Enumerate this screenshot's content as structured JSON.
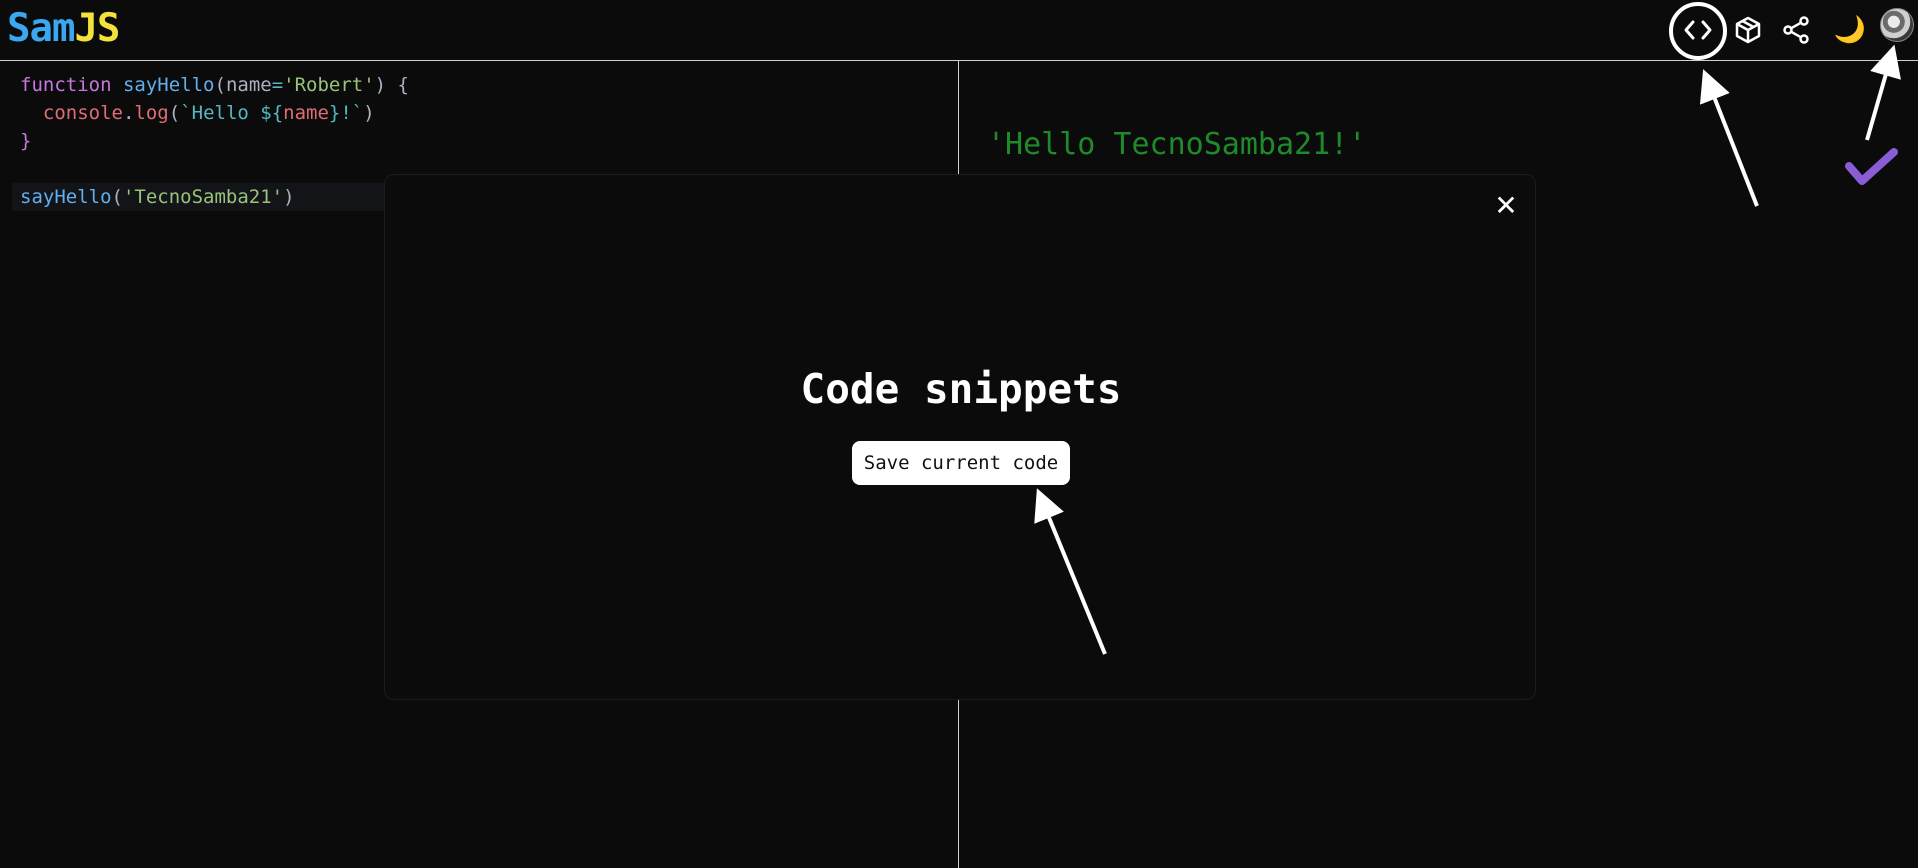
{
  "header": {
    "logo_sam": "Sam",
    "logo_js": "JS",
    "toolbar": [
      {
        "name": "code-snippets",
        "icon": "code-brackets-icon"
      },
      {
        "name": "packages",
        "icon": "package-icon"
      },
      {
        "name": "share",
        "icon": "share-icon"
      },
      {
        "name": "theme",
        "icon": "moon-icon",
        "glyph": "🌙"
      },
      {
        "name": "user",
        "icon": "avatar"
      }
    ]
  },
  "editor": {
    "lines": [
      {
        "id": 1,
        "tokens": [
          "function",
          " ",
          "sayHello",
          "(",
          "name",
          "=",
          "'Robert'",
          ") {"
        ]
      },
      {
        "id": 2,
        "tokens": [
          "  ",
          "console",
          ".",
          "log",
          "(",
          "`Hello ${",
          "name",
          "}!`",
          ")"
        ]
      },
      {
        "id": 3,
        "tokens": [
          "}"
        ]
      },
      {
        "id": 5,
        "tokens": [
          "sayHello",
          "(",
          "'TecnoSamba21'",
          ")"
        ]
      }
    ]
  },
  "output": {
    "lines": [
      "'Hello TecnoSamba21!'"
    ]
  },
  "modal": {
    "close_glyph": "✕",
    "title": "Code snippets",
    "save_label": "Save current code"
  },
  "annotations": {
    "checkmark_color": "#8a5cd6",
    "arrow_color": "#ffffff",
    "ring_color": "#ffffff"
  }
}
